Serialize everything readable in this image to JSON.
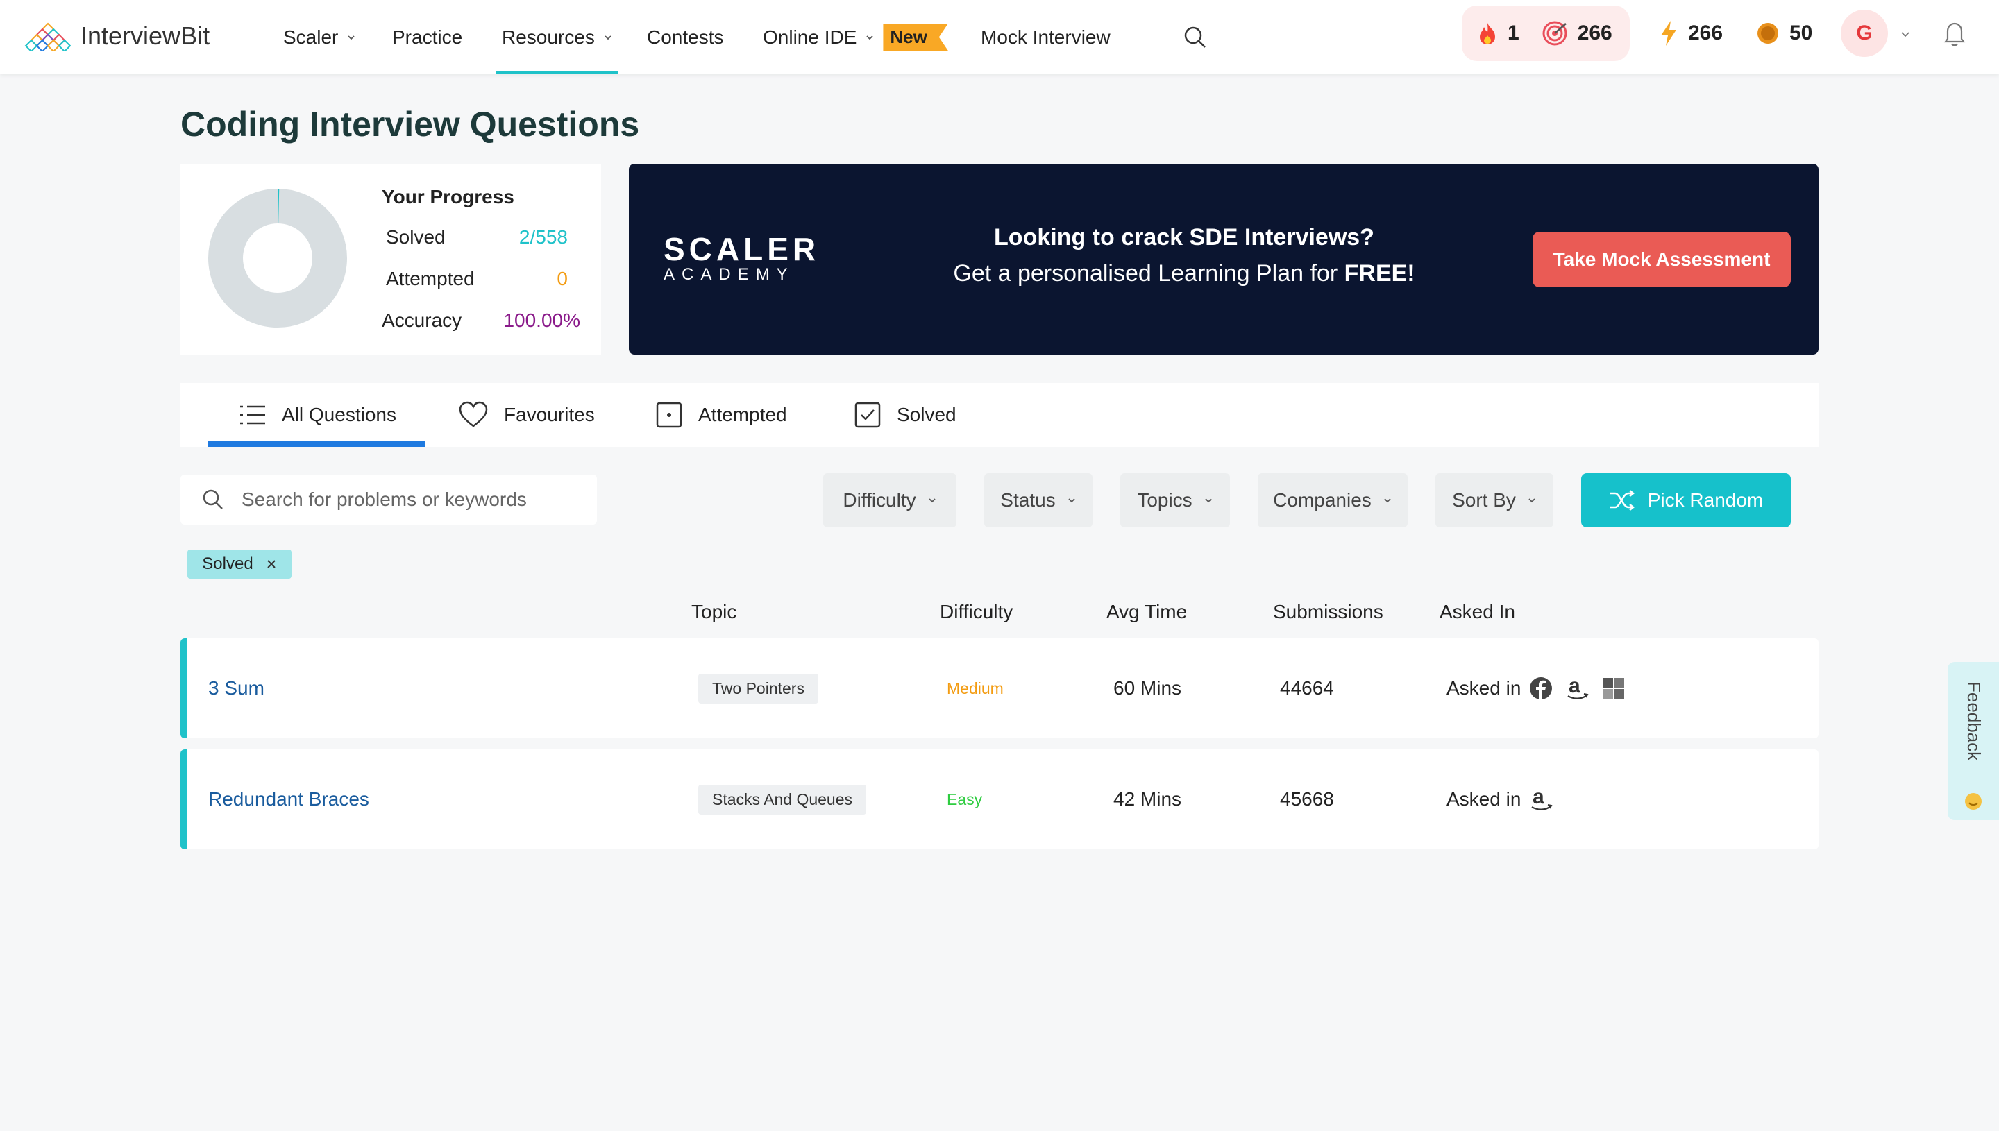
{
  "brand": {
    "name_a": "Interview",
    "name_b": "Bit"
  },
  "nav": {
    "items": [
      {
        "label": "Scaler",
        "dropdown": true
      },
      {
        "label": "Practice",
        "dropdown": false
      },
      {
        "label": "Resources",
        "dropdown": true,
        "active": true
      },
      {
        "label": "Contests",
        "dropdown": false
      },
      {
        "label": "Online IDE",
        "dropdown": true
      },
      {
        "label": "Mock Interview",
        "dropdown": false
      }
    ],
    "new_badge": "New"
  },
  "user_stats": {
    "streak": "1",
    "target": "266",
    "lightning": "266",
    "coins": "50",
    "avatar_letter": "G"
  },
  "page": {
    "title": "Coding Interview Questions"
  },
  "progress": {
    "title": "Your Progress",
    "solved_label": "Solved",
    "solved_value": "2/558",
    "solved_fraction": 0.0036,
    "attempted_label": "Attempted",
    "attempted_value": "0",
    "accuracy_label": "Accuracy",
    "accuracy_value": "100.00%"
  },
  "banner": {
    "logo_main": "SCALER",
    "logo_sub": "ACADEMY",
    "line1": "Looking to crack SDE Interviews?",
    "line2_prefix": "Get a personalised Learning Plan for ",
    "line2_bold": "FREE!",
    "cta": "Take Mock Assessment"
  },
  "tabs": [
    {
      "label": "All Questions",
      "icon": "list-icon",
      "active": true
    },
    {
      "label": "Favourites",
      "icon": "heart-icon"
    },
    {
      "label": "Attempted",
      "icon": "dot-square-icon"
    },
    {
      "label": "Solved",
      "icon": "check-square-icon"
    }
  ],
  "search": {
    "placeholder": "Search for problems or keywords",
    "value": ""
  },
  "filters": {
    "difficulty": "Difficulty",
    "status": "Status",
    "topics": "Topics",
    "companies": "Companies",
    "sort": "Sort By",
    "pick_random": "Pick Random"
  },
  "active_filter_chip": "Solved",
  "table": {
    "headers": {
      "topic": "Topic",
      "difficulty": "Difficulty",
      "avg_time": "Avg Time",
      "submissions": "Submissions",
      "asked_in": "Asked In"
    },
    "asked_in_prefix": "Asked in",
    "rows": [
      {
        "title": "3 Sum",
        "topic": "Two Pointers",
        "difficulty": "Medium",
        "difficulty_color": "#f39c12",
        "avg_time": "60 Mins",
        "submissions": "44664",
        "companies": [
          "facebook-icon",
          "amazon-icon",
          "microsoft-icon"
        ]
      },
      {
        "title": "Redundant Braces",
        "topic": "Stacks And Queues",
        "difficulty": "Easy",
        "difficulty_color": "#2ecc40",
        "avg_time": "42 Mins",
        "submissions": "45668",
        "companies": [
          "amazon-icon"
        ]
      }
    ]
  },
  "feedback_label": "Feedback",
  "colors": {
    "accent": "#1fc2c9",
    "tab_underline": "#1f7ae0",
    "banner_bg": "#0b1530",
    "cta": "#ea5b55"
  }
}
